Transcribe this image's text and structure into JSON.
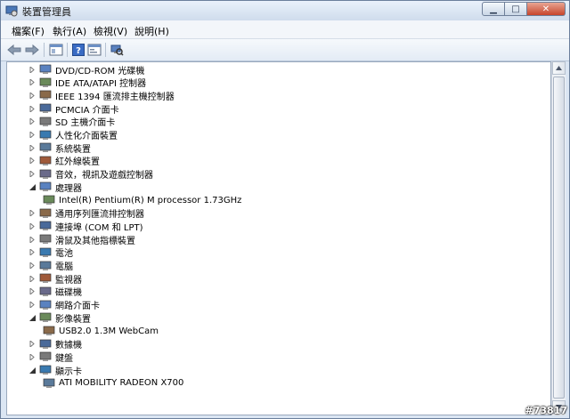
{
  "window": {
    "title": "裝置管理員"
  },
  "menu": [
    "檔案(F)",
    "執行(A)",
    "檢視(V)",
    "說明(H)"
  ],
  "tree": [
    {
      "label": "DVD/CD-ROM 光碟機",
      "level": 0,
      "expanded": false,
      "icon": "dvd-drive-icon"
    },
    {
      "label": "IDE ATA/ATAPI 控制器",
      "level": 0,
      "expanded": false,
      "icon": "ide-controller-icon"
    },
    {
      "label": "IEEE 1394 匯流排主機控制器",
      "level": 0,
      "expanded": false,
      "icon": "firewire-icon"
    },
    {
      "label": "PCMCIA 介面卡",
      "level": 0,
      "expanded": false,
      "icon": "pcmcia-icon"
    },
    {
      "label": "SD 主機介面卡",
      "level": 0,
      "expanded": false,
      "icon": "sd-host-icon"
    },
    {
      "label": "人性化介面裝置",
      "level": 0,
      "expanded": false,
      "icon": "hid-icon"
    },
    {
      "label": "系統裝置",
      "level": 0,
      "expanded": false,
      "icon": "system-device-icon"
    },
    {
      "label": "紅外線裝置",
      "level": 0,
      "expanded": false,
      "icon": "infrared-icon"
    },
    {
      "label": "音效，視訊及遊戲控制器",
      "level": 0,
      "expanded": false,
      "icon": "sound-icon"
    },
    {
      "label": "處理器",
      "level": 0,
      "expanded": true,
      "icon": "processor-icon"
    },
    {
      "label": "Intel(R) Pentium(R) M processor 1.73GHz",
      "level": 1,
      "expanded": null,
      "icon": "cpu-chip-icon"
    },
    {
      "label": "通用序列匯流排控制器",
      "level": 0,
      "expanded": false,
      "icon": "usb-controller-icon"
    },
    {
      "label": "連接埠 (COM 和 LPT)",
      "level": 0,
      "expanded": false,
      "icon": "port-icon"
    },
    {
      "label": "滑鼠及其他指標裝置",
      "level": 0,
      "expanded": false,
      "icon": "mouse-icon"
    },
    {
      "label": "電池",
      "level": 0,
      "expanded": false,
      "icon": "battery-icon"
    },
    {
      "label": "電腦",
      "level": 0,
      "expanded": false,
      "icon": "computer-icon"
    },
    {
      "label": "監視器",
      "level": 0,
      "expanded": false,
      "icon": "monitor-icon"
    },
    {
      "label": "磁碟機",
      "level": 0,
      "expanded": false,
      "icon": "disk-drive-icon"
    },
    {
      "label": "網路介面卡",
      "level": 0,
      "expanded": false,
      "icon": "network-adapter-icon"
    },
    {
      "label": "影像裝置",
      "level": 0,
      "expanded": true,
      "icon": "imaging-icon"
    },
    {
      "label": "USB2.0 1.3M WebCam",
      "level": 1,
      "expanded": null,
      "icon": "webcam-icon"
    },
    {
      "label": "數據機",
      "level": 0,
      "expanded": false,
      "icon": "modem-icon"
    },
    {
      "label": "鍵盤",
      "level": 0,
      "expanded": false,
      "icon": "keyboard-icon"
    },
    {
      "label": "顯示卡",
      "level": 0,
      "expanded": true,
      "icon": "display-adapter-icon"
    },
    {
      "label": "ATI MOBILITY RADEON X700",
      "level": 1,
      "expanded": null,
      "icon": "gpu-icon"
    }
  ],
  "watermark": "#73817"
}
